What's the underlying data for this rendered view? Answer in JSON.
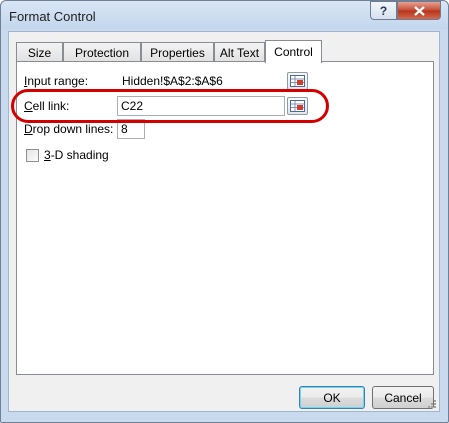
{
  "window": {
    "title": "Format Control"
  },
  "tabs": [
    {
      "label": "Size",
      "active": false
    },
    {
      "label": "Protection",
      "active": false
    },
    {
      "label": "Properties",
      "active": false
    },
    {
      "label": "Alt Text",
      "active": false
    },
    {
      "label": "Control",
      "active": true
    }
  ],
  "control": {
    "input_range": {
      "label_key": "I",
      "label_rest": "nput range:",
      "value": "Hidden!$A$2:$A$6"
    },
    "cell_link": {
      "label_key": "C",
      "label_rest": "ell link:",
      "value": "C22"
    },
    "drop_down_lines": {
      "label_key": "D",
      "label_rest": "rop down lines:",
      "value": "8"
    },
    "shading": {
      "label_key": "3",
      "label_rest": "-D shading",
      "checked": false
    }
  },
  "buttons": {
    "ok": "OK",
    "cancel": "Cancel"
  },
  "icons": {
    "help": "help-icon",
    "close": "close-icon",
    "range_select": "range-select-icon"
  },
  "colors": {
    "highlight": "#d40000",
    "titlebar": "#c9daee"
  }
}
